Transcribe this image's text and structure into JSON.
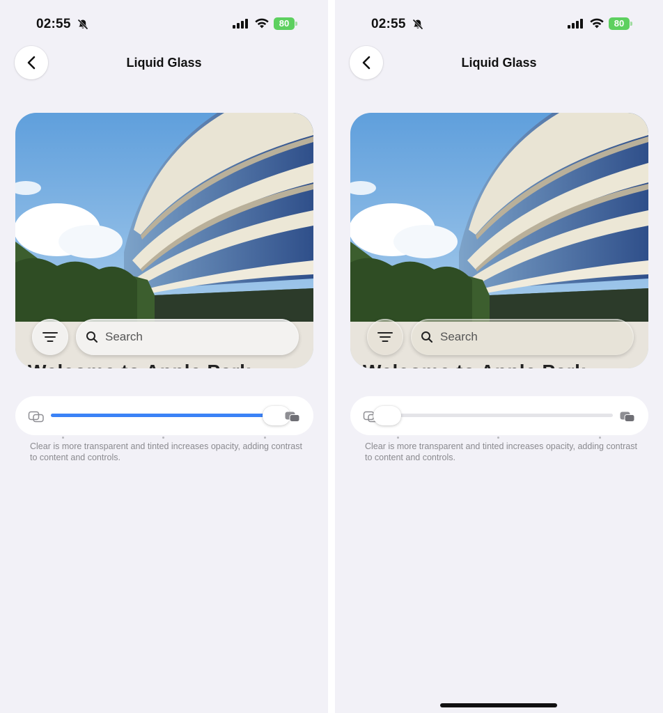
{
  "screens": [
    {
      "status": {
        "time": "02:55",
        "battery": "80"
      },
      "nav": {
        "title": "Liquid Glass"
      },
      "preview": {
        "search_placeholder": "Search",
        "caption": "Welcome to Apple Park"
      },
      "slider": {
        "value": 1.0,
        "setting": "tinted"
      },
      "footnote": "Clear is more transparent and tinted increases opacity, adding contrast to content and controls."
    },
    {
      "status": {
        "time": "02:55",
        "battery": "80"
      },
      "nav": {
        "title": "Liquid Glass"
      },
      "preview": {
        "search_placeholder": "Search",
        "caption": "Welcome to Apple Park"
      },
      "slider": {
        "value": 0.0,
        "setting": "clear"
      },
      "footnote": "Clear is more transparent and tinted increases opacity, adding contrast to content and controls."
    }
  ],
  "colors": {
    "accent": "#3b82f6",
    "background": "#f2f1f7",
    "battery": "#5dd05f"
  },
  "icons": [
    "bell-slash-icon",
    "cellular-signal-icon",
    "wifi-icon",
    "battery-icon",
    "chevron-left-icon",
    "filter-lines-icon",
    "search-icon",
    "clear-glass-icon",
    "tinted-glass-icon"
  ]
}
